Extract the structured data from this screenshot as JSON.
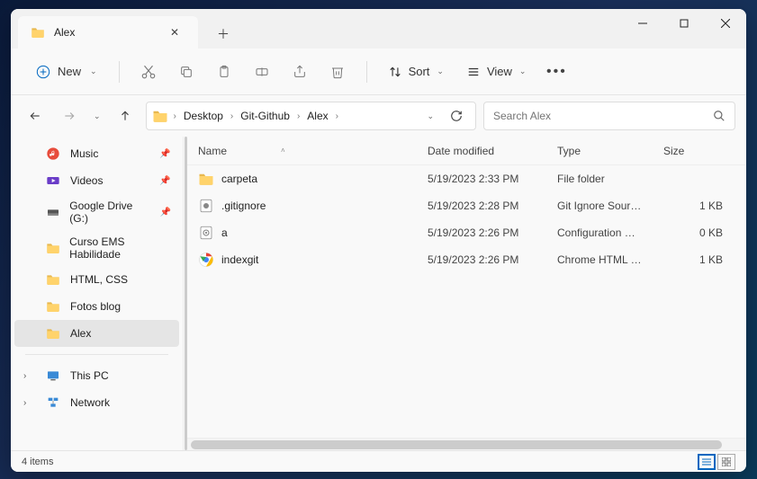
{
  "window": {
    "tab_title": "Alex",
    "search_placeholder": "Search Alex"
  },
  "toolbar": {
    "new_label": "New",
    "sort_label": "Sort",
    "view_label": "View"
  },
  "breadcrumb": {
    "items": [
      "Desktop",
      "Git-Github",
      "Alex"
    ]
  },
  "columns": {
    "name": "Name",
    "date": "Date modified",
    "type": "Type",
    "size": "Size"
  },
  "sidebar": {
    "items": [
      {
        "label": "Music",
        "icon": "music",
        "pinned": true
      },
      {
        "label": "Videos",
        "icon": "videos",
        "pinned": true
      },
      {
        "label": "Google Drive (G:)",
        "icon": "drive",
        "pinned": true
      },
      {
        "label": "Curso EMS Habilidade",
        "icon": "folder",
        "pinned": false
      },
      {
        "label": "HTML, CSS",
        "icon": "folder",
        "pinned": false
      },
      {
        "label": "Fotos blog",
        "icon": "folder",
        "pinned": false
      },
      {
        "label": "Alex",
        "icon": "folder",
        "pinned": false,
        "active": true
      }
    ],
    "lower": [
      {
        "label": "This PC",
        "icon": "pc"
      },
      {
        "label": "Network",
        "icon": "network"
      }
    ]
  },
  "files": [
    {
      "name": "carpeta",
      "date": "5/19/2023 2:33 PM",
      "type": "File folder",
      "size": "",
      "icon": "folder"
    },
    {
      "name": ".gitignore",
      "date": "5/19/2023 2:28 PM",
      "type": "Git Ignore Source ...",
      "size": "1 KB",
      "icon": "gitignore"
    },
    {
      "name": "a",
      "date": "5/19/2023 2:26 PM",
      "type": "Configuration Sou...",
      "size": "0 KB",
      "icon": "config"
    },
    {
      "name": "indexgit",
      "date": "5/19/2023 2:26 PM",
      "type": "Chrome HTML Do...",
      "size": "1 KB",
      "icon": "chrome"
    }
  ],
  "status": {
    "count": "4 items"
  }
}
